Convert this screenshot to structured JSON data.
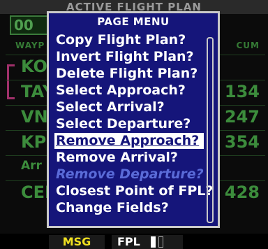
{
  "background": {
    "title": "ACTIVE FLIGHT PLAN",
    "plan_number": "00",
    "col_left": "WAYP",
    "col_right": "CUM",
    "waypoints": [
      "KOF",
      "TAY",
      "VNA",
      "KPD",
      "Arr",
      "CEP"
    ],
    "cum_values": [
      "",
      "134",
      "247",
      "354",
      "",
      "428"
    ]
  },
  "menu": {
    "title": "PAGE MENU",
    "items": [
      "Copy Flight Plan?",
      "Invert Flight Plan?",
      "Delete Flight Plan?",
      "Select Approach?",
      "Select Arrival?",
      "Select Departure?",
      "Remove Approach?",
      "Remove Arrival?",
      "Remove Departure?",
      "Closest Point of FPL?",
      "Change Fields?"
    ],
    "selected_index": 6,
    "disabled_index": 8
  },
  "status": {
    "msg": "MSG",
    "page": "FPL"
  },
  "colors": {
    "menu_bg": "#15157a",
    "menu_text": "#ffffff",
    "selected_bg": "#ffffff",
    "disabled_text": "#5a6bd8",
    "msg_text": "#f0e020",
    "background_green": "#3c8c3c"
  }
}
